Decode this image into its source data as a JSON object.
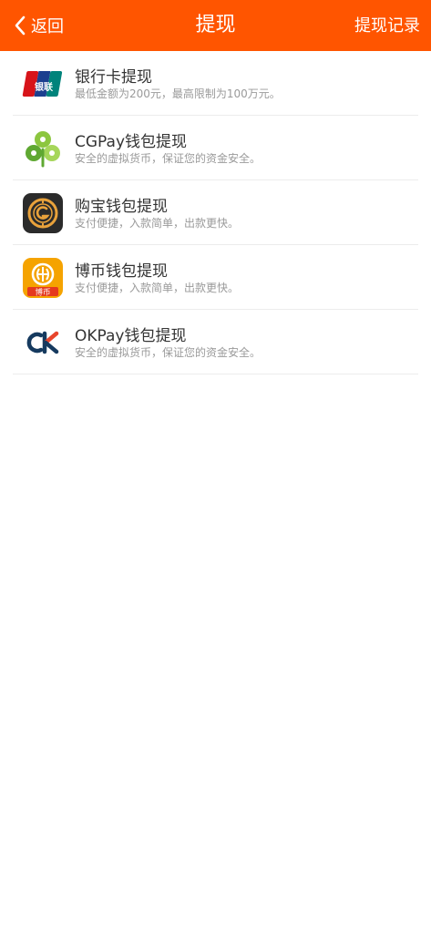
{
  "header": {
    "back_label": "返回",
    "title": "提现",
    "records_label": "提现记录",
    "background_color": "#ff5500"
  },
  "methods": [
    {
      "name": "银行卡提现",
      "description": "最低金额为200元，最高限制为100万元。",
      "icon": "unionpay-icon"
    },
    {
      "name": "CGPay钱包提现",
      "description": "安全的虚拟货币，保证您的资金安全。",
      "icon": "cgpay-clover-icon"
    },
    {
      "name": "购宝钱包提现",
      "description": "支付便捷，入款简单，出款更快。",
      "icon": "goubao-coin-icon"
    },
    {
      "name": "博币钱包提现",
      "description": "支付便捷，入款简单，出款更快。",
      "icon": "bobi-icon",
      "icon_text": "博币"
    },
    {
      "name": "OKPay钱包提现",
      "description": "安全的虚拟货币，保证您的资金安全。",
      "icon": "okpay-icon"
    }
  ]
}
